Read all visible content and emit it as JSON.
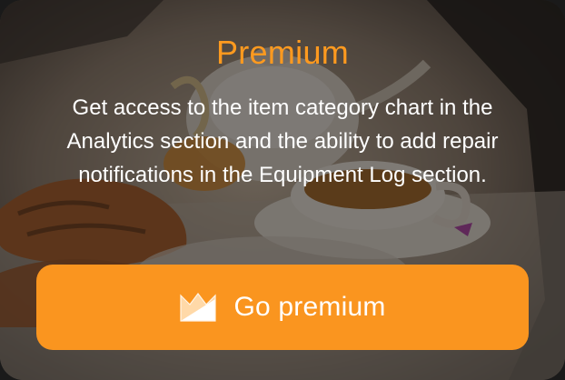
{
  "colors": {
    "accent": "#ff9a1f",
    "button": "#fa951f",
    "text": "#ffffff"
  },
  "premium_card": {
    "title": "Premium",
    "description": "Get access to the item category chart in the Analytics section and the ability to add repair notifications in the Equipment Log section.",
    "cta": {
      "label": "Go premium",
      "icon": "premium-crown-icon"
    },
    "background": "tea-and-croissants-illustration"
  }
}
